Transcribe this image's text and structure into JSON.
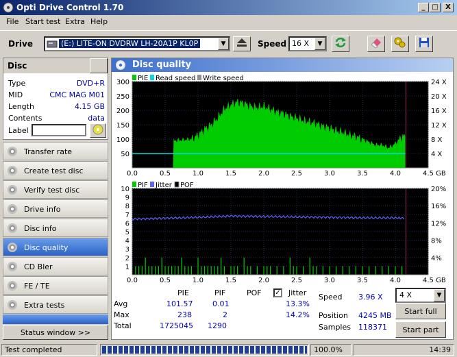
{
  "window": {
    "title": "Opti Drive Control 1.70",
    "min": "_",
    "max": "□",
    "close": "X"
  },
  "menu": [
    "File",
    "Start test",
    "Extra",
    "Help"
  ],
  "toolbar": {
    "drive_label": "Drive",
    "drive_value": "(E:)  LITE-ON DVDRW LH-20A1P KL0P",
    "speed_label": "Speed",
    "speed_value": "16 X"
  },
  "disc": {
    "header": "Disc",
    "type_label": "Type",
    "type": "DVD+R",
    "mid_label": "MID",
    "mid": "CMC MAG M01",
    "length_label": "Length",
    "length": "4.15 GB",
    "contents_label": "Contents",
    "contents": "data",
    "label_label": "Label",
    "label_value": ""
  },
  "nav": [
    {
      "label": "Transfer rate",
      "active": false
    },
    {
      "label": "Create test disc",
      "active": false
    },
    {
      "label": "Verify test disc",
      "active": false
    },
    {
      "label": "Drive info",
      "active": false
    },
    {
      "label": "Disc info",
      "active": false
    },
    {
      "label": "Disc quality",
      "active": true
    },
    {
      "label": "CD Bler",
      "active": false
    },
    {
      "label": "FE / TE",
      "active": false
    },
    {
      "label": "Extra tests",
      "active": false
    }
  ],
  "status_window": "Status window >>",
  "panel_title": "Disc quality",
  "chart_data": [
    {
      "type": "area",
      "legend": [
        "PIE",
        "Read speed",
        "Write speed"
      ],
      "colors": {
        "pie": "#00cc00",
        "read": "#00dddd",
        "write": "#909090"
      },
      "x_ticks": [
        "0.0",
        "0.5",
        "1.0",
        "1.5",
        "2.0",
        "2.5",
        "3.0",
        "3.5",
        "4.0",
        "4.5 GB"
      ],
      "xlim": [
        0,
        4.5
      ],
      "y_ticks": [
        "50",
        "100",
        "150",
        "200",
        "250",
        "300"
      ],
      "ylim": [
        0,
        300
      ],
      "y2_ticks": [
        "4 X",
        "8 X",
        "12 X",
        "16 X",
        "20 X",
        "24 X"
      ],
      "y2lim": [
        0,
        24
      ],
      "pie_envelope": [
        [
          0.0,
          0
        ],
        [
          0.62,
          0
        ],
        [
          0.63,
          95
        ],
        [
          0.9,
          100
        ],
        [
          1.0,
          115
        ],
        [
          1.1,
          135
        ],
        [
          1.2,
          150
        ],
        [
          1.3,
          175
        ],
        [
          1.4,
          205
        ],
        [
          1.5,
          220
        ],
        [
          1.6,
          230
        ],
        [
          1.7,
          225
        ],
        [
          1.8,
          215
        ],
        [
          1.9,
          210
        ],
        [
          2.0,
          215
        ],
        [
          2.1,
          205
        ],
        [
          2.2,
          195
        ],
        [
          2.3,
          190
        ],
        [
          2.4,
          180
        ],
        [
          2.5,
          175
        ],
        [
          2.6,
          165
        ],
        [
          2.7,
          160
        ],
        [
          2.8,
          155
        ],
        [
          2.9,
          145
        ],
        [
          3.0,
          140
        ],
        [
          3.1,
          130
        ],
        [
          3.2,
          125
        ],
        [
          3.3,
          115
        ],
        [
          3.4,
          110
        ],
        [
          3.5,
          100
        ],
        [
          3.6,
          90
        ],
        [
          3.7,
          80
        ],
        [
          3.8,
          80
        ],
        [
          3.9,
          70
        ],
        [
          4.0,
          85
        ],
        [
          4.1,
          110
        ],
        [
          4.15,
          110
        ]
      ],
      "read_speed": [
        [
          0.0,
          3.96
        ],
        [
          4.15,
          3.96
        ]
      ]
    },
    {
      "type": "bar",
      "legend": [
        "PIF",
        "Jitter",
        "POF"
      ],
      "colors": {
        "pif": "#00cc00",
        "jitter": "#6060ff",
        "pof": "#000000"
      },
      "x_ticks": [
        "0.0",
        "0.5",
        "1.0",
        "1.5",
        "2.0",
        "2.5",
        "3.0",
        "3.5",
        "4.0",
        "4.5 GB"
      ],
      "xlim": [
        0,
        4.5
      ],
      "y_ticks": [
        "1",
        "2",
        "3",
        "4",
        "5",
        "6",
        "7",
        "8",
        "9",
        "10"
      ],
      "ylim": [
        0,
        10
      ],
      "y2_ticks": [
        "4%",
        "8%",
        "12%",
        "16%",
        "20%"
      ],
      "y2lim": [
        0,
        20
      ],
      "pif_spikes": [
        [
          0.05,
          1
        ],
        [
          0.1,
          1
        ],
        [
          0.15,
          1
        ],
        [
          0.2,
          2
        ],
        [
          0.25,
          1
        ],
        [
          0.3,
          1
        ],
        [
          0.35,
          1
        ],
        [
          0.4,
          1
        ],
        [
          0.45,
          2
        ],
        [
          0.5,
          1
        ],
        [
          0.55,
          1
        ],
        [
          0.6,
          1
        ],
        [
          0.65,
          1
        ],
        [
          0.7,
          1
        ],
        [
          0.75,
          2
        ],
        [
          0.8,
          1
        ],
        [
          0.85,
          1
        ],
        [
          0.9,
          1
        ],
        [
          1.0,
          2
        ],
        [
          1.05,
          1
        ],
        [
          1.1,
          1
        ],
        [
          1.15,
          1
        ],
        [
          1.2,
          1
        ],
        [
          1.25,
          1
        ],
        [
          1.3,
          1
        ],
        [
          1.35,
          2
        ],
        [
          1.4,
          1
        ],
        [
          1.5,
          1
        ],
        [
          1.55,
          1
        ],
        [
          1.6,
          1
        ],
        [
          1.7,
          2
        ],
        [
          1.75,
          1
        ],
        [
          1.8,
          1
        ],
        [
          1.9,
          1
        ],
        [
          2.0,
          1
        ],
        [
          2.05,
          1
        ],
        [
          2.1,
          1
        ],
        [
          2.2,
          1
        ],
        [
          2.3,
          1
        ],
        [
          2.4,
          2
        ],
        [
          2.45,
          1
        ],
        [
          2.5,
          1
        ],
        [
          2.6,
          1
        ],
        [
          2.7,
          2
        ],
        [
          2.75,
          1
        ],
        [
          2.8,
          1
        ],
        [
          2.9,
          1
        ],
        [
          3.0,
          1
        ],
        [
          3.1,
          1
        ],
        [
          3.2,
          1
        ],
        [
          3.3,
          1
        ],
        [
          3.4,
          1
        ],
        [
          3.5,
          1
        ],
        [
          3.6,
          1
        ],
        [
          3.7,
          1
        ],
        [
          3.8,
          1
        ],
        [
          3.9,
          1
        ],
        [
          4.0,
          1
        ],
        [
          4.1,
          1
        ]
      ],
      "jitter": [
        [
          0.0,
          12.9
        ],
        [
          0.5,
          13.1
        ],
        [
          1.0,
          13.3
        ],
        [
          1.5,
          13.6
        ],
        [
          2.0,
          13.5
        ],
        [
          2.5,
          13.4
        ],
        [
          3.0,
          13.3
        ],
        [
          3.5,
          13.2
        ],
        [
          4.0,
          13.2
        ],
        [
          4.15,
          13.1
        ]
      ]
    }
  ],
  "stats": {
    "col_pie": "PIE",
    "col_pif": "PIF",
    "col_pof": "POF",
    "col_jitter": "Jitter",
    "jitter_checked": true,
    "avg_label": "Avg",
    "avg_pie": "101.57",
    "avg_pif": "0.01",
    "avg_jitter": "13.3%",
    "max_label": "Max",
    "max_pie": "238",
    "max_pif": "2",
    "max_jitter": "14.2%",
    "total_label": "Total",
    "total_pie": "1725045",
    "total_pif": "1290",
    "speed_label": "Speed",
    "speed_value": "3.96 X",
    "speed_select": "4 X",
    "position_label": "Position",
    "position_value": "4245 MB",
    "samples_label": "Samples",
    "samples_value": "118371",
    "start_full": "Start full",
    "start_part": "Start part"
  },
  "statusbar": {
    "text": "Test completed",
    "progress": 1.0,
    "percent": "100.0%",
    "time": "14:39"
  }
}
